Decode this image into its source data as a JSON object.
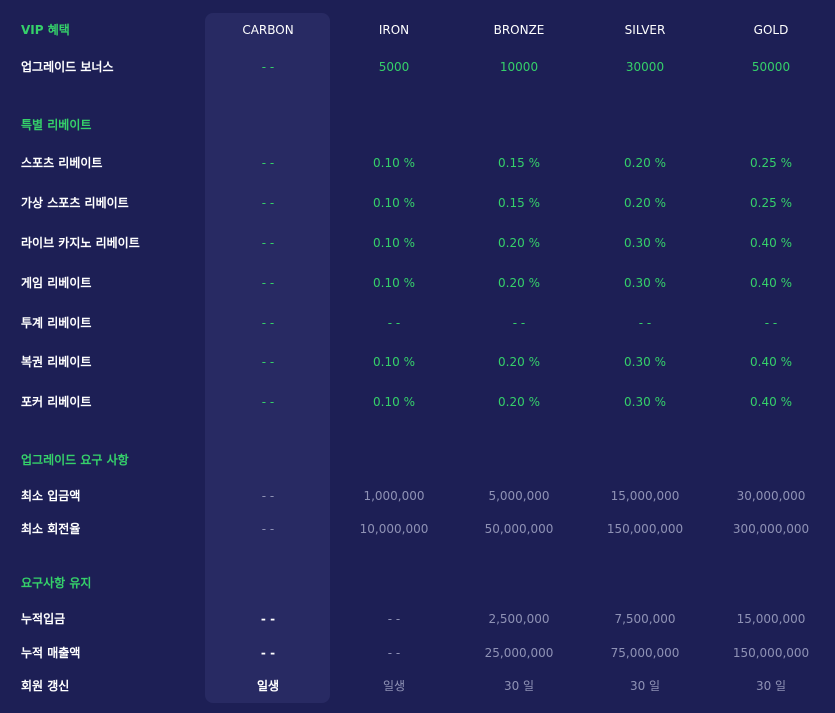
{
  "header": {
    "title": "VIP 혜택",
    "tiers": [
      "CARBON",
      "IRON",
      "BRONZE",
      "SILVER",
      "GOLD"
    ]
  },
  "upgrade_bonus": {
    "label": "업그레이드 보너스",
    "values": [
      "- -",
      "5000",
      "10000",
      "30000",
      "50000"
    ]
  },
  "special_rebate": {
    "title": "특별 리베이트",
    "rows": [
      {
        "label": "스포츠 리베이트",
        "values": [
          "- -",
          "0.10 %",
          "0.15 %",
          "0.20 %",
          "0.25 %"
        ]
      },
      {
        "label": "가상 스포츠 리베이트",
        "values": [
          "- -",
          "0.10 %",
          "0.15 %",
          "0.20 %",
          "0.25 %"
        ]
      },
      {
        "label": "라이브 카지노 리베이트",
        "values": [
          "- -",
          "0.10 %",
          "0.20 %",
          "0.30 %",
          "0.40 %"
        ]
      },
      {
        "label": "게임 리베이트",
        "values": [
          "- -",
          "0.10 %",
          "0.20 %",
          "0.30 %",
          "0.40 %"
        ]
      },
      {
        "label": "투계 리베이트",
        "values": [
          "- -",
          "- -",
          "- -",
          "- -",
          "- -"
        ]
      },
      {
        "label": "복권 리베이트",
        "values": [
          "- -",
          "0.10 %",
          "0.20 %",
          "0.30 %",
          "0.40 %"
        ]
      },
      {
        "label": "포커 리베이트",
        "values": [
          "- -",
          "0.10 %",
          "0.20 %",
          "0.30 %",
          "0.40 %"
        ]
      }
    ]
  },
  "upgrade_requirements": {
    "title": "업그레이드 요구 사항",
    "rows": [
      {
        "label": "최소 입금액",
        "values": [
          "- -",
          "1,000,000",
          "5,000,000",
          "15,000,000",
          "30,000,000"
        ]
      },
      {
        "label": "최소 회전율",
        "values": [
          "- -",
          "10,000,000",
          "50,000,000",
          "150,000,000",
          "300,000,000"
        ]
      }
    ]
  },
  "maintain_requirements": {
    "title": "요구사항 유지",
    "rows": [
      {
        "label": "누적입금",
        "values": [
          "- -",
          "- -",
          "2,500,000",
          "7,500,000",
          "15,000,000"
        ]
      },
      {
        "label": "누적 매출액",
        "values": [
          "- -",
          "- -",
          "25,000,000",
          "75,000,000",
          "150,000,000"
        ]
      },
      {
        "label": "회원 갱신",
        "values": [
          "일생",
          "일생",
          "30 일",
          "30 일",
          "30 일"
        ]
      }
    ]
  }
}
